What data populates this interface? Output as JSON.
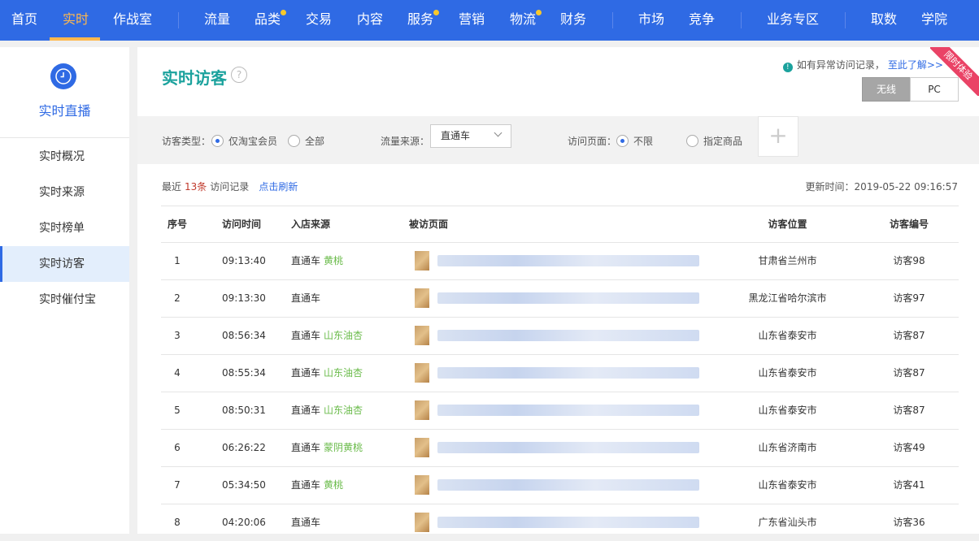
{
  "topnav": {
    "items": [
      {
        "label": "首页",
        "active": false
      },
      {
        "label": "实时",
        "active": true
      },
      {
        "label": "作战室",
        "active": false
      },
      {
        "label": "流量",
        "active": false
      },
      {
        "label": "品类",
        "active": false,
        "dot": true
      },
      {
        "label": "交易",
        "active": false
      },
      {
        "label": "内容",
        "active": false
      },
      {
        "label": "服务",
        "active": false,
        "dot": true
      },
      {
        "label": "营销",
        "active": false
      },
      {
        "label": "物流",
        "active": false,
        "dot": true
      },
      {
        "label": "财务",
        "active": false
      },
      {
        "label": "市场",
        "active": false
      },
      {
        "label": "竞争",
        "active": false
      },
      {
        "label": "业务专区",
        "active": false
      },
      {
        "label": "取数",
        "active": false
      },
      {
        "label": "学院",
        "active": false
      }
    ],
    "colors": {
      "bg": "#2f6ae4",
      "active": "#ffb84d",
      "dot": "#f7c82b"
    }
  },
  "sidebar": {
    "icon": "clock-icon",
    "title": "实时直播",
    "items": [
      {
        "label": "实时概况",
        "active": false
      },
      {
        "label": "实时来源",
        "active": false
      },
      {
        "label": "实时榜单",
        "active": false
      },
      {
        "label": "实时访客",
        "active": true
      },
      {
        "label": "实时催付宝",
        "active": false
      }
    ]
  },
  "header": {
    "title": "实时访客",
    "help_icon": "question-icon",
    "notice_text": "如有异常访问记录，",
    "notice_link": "至此了解>>",
    "ribbon": "限时体验",
    "toggle": {
      "on": "无线",
      "off": "PC"
    }
  },
  "filters": {
    "visitor_type_label": "访客类型：",
    "visitor_type_options": [
      "仅淘宝会员",
      "全部"
    ],
    "visitor_type_selected": "仅淘宝会员",
    "source_label": "流量来源：",
    "source_value": "直通车",
    "page_label": "访问页面：",
    "page_options": [
      "不限",
      "指定商品"
    ],
    "page_selected": "不限",
    "add_icon": "plus-icon"
  },
  "summary": {
    "prefix": "最近",
    "count": "13条",
    "suffix": "访问记录",
    "refresh": "点击刷新",
    "update_time": "更新时间：2019-05-22 09:16:57"
  },
  "table": {
    "headers": [
      "序号",
      "访问时间",
      "入店来源",
      "被访页面",
      "访客位置",
      "访客编号"
    ],
    "rows": [
      {
        "no": "1",
        "time": "09:13:40",
        "source": "直通车",
        "keyword": "黄桃",
        "location": "甘肃省兰州市",
        "visitor": "访客98"
      },
      {
        "no": "2",
        "time": "09:13:30",
        "source": "直通车",
        "keyword": "",
        "location": "黑龙江省哈尔滨市",
        "visitor": "访客97"
      },
      {
        "no": "3",
        "time": "08:56:34",
        "source": "直通车",
        "keyword": "山东油杏",
        "location": "山东省泰安市",
        "visitor": "访客87"
      },
      {
        "no": "4",
        "time": "08:55:34",
        "source": "直通车",
        "keyword": "山东油杏",
        "location": "山东省泰安市",
        "visitor": "访客87"
      },
      {
        "no": "5",
        "time": "08:50:31",
        "source": "直通车",
        "keyword": "山东油杏",
        "location": "山东省泰安市",
        "visitor": "访客87"
      },
      {
        "no": "6",
        "time": "06:26:22",
        "source": "直通车",
        "keyword": "蒙阴黄桃",
        "location": "山东省济南市",
        "visitor": "访客49"
      },
      {
        "no": "7",
        "time": "05:34:50",
        "source": "直通车",
        "keyword": "黄桃",
        "location": "山东省泰安市",
        "visitor": "访客41"
      },
      {
        "no": "8",
        "time": "04:20:06",
        "source": "直通车",
        "keyword": "",
        "location": "广东省汕头市",
        "visitor": "访客36"
      }
    ]
  }
}
